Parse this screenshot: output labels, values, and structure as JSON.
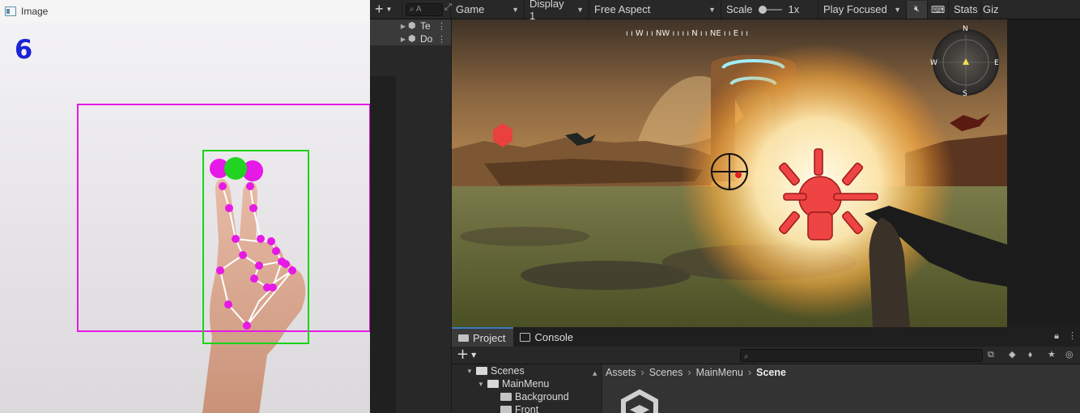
{
  "image_window": {
    "title": "Image",
    "overlay_count": "6"
  },
  "unity": {
    "toolbar": {
      "add_label": "+",
      "search_placeholder": "A",
      "view_mode": "Game",
      "display": "Display 1",
      "aspect": "Free Aspect",
      "scale_label": "Scale",
      "scale_value": "1x",
      "play_mode": "Play Focused",
      "stats_label": "Stats",
      "gizmos_label": "Gizı"
    },
    "hierarchy": {
      "items": [
        {
          "label": "Te"
        },
        {
          "label": "Do"
        }
      ]
    },
    "hud": {
      "compass_strip": "ı ı W ı ı NW ı ı ı ı N ı ı NE ı ı E ı ı",
      "minimap": {
        "n": "N",
        "s": "S",
        "e": "E",
        "w": "W"
      }
    },
    "bottom": {
      "tabs": [
        {
          "label": "Project"
        },
        {
          "label": "Console"
        }
      ],
      "add_label": "+",
      "tree": [
        {
          "label": "Scenes"
        },
        {
          "label": "MainMenu"
        },
        {
          "label": "Background"
        },
        {
          "label": "Front"
        }
      ],
      "breadcrumb": [
        "Assets",
        "Scenes",
        "MainMenu",
        "Scene"
      ]
    }
  },
  "colors": {
    "hand_bbox": "#19d419",
    "landmark": "#e619e6",
    "index_tip": "#22d422",
    "count_text": "#1c22d6",
    "explosion": "#fff6d8",
    "gesture_icon": "#ee4444"
  }
}
